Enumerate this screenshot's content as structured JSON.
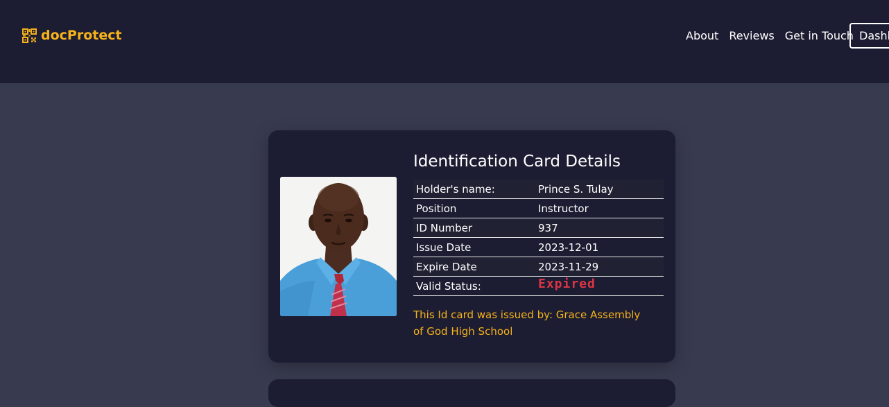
{
  "navbar": {
    "brand": "docProtect",
    "brand_icon": "qr-code-icon",
    "brand_color": "#f7b21b",
    "links": [
      "About",
      "Reviews",
      "Get in Touch"
    ],
    "dashboard_button": "Dashb"
  },
  "card": {
    "title": "Identification Card Details",
    "photo": "id-photo",
    "rows": [
      {
        "label": "Holder's name:",
        "value": "Prince S. Tulay"
      },
      {
        "label": "Position",
        "value": "Instructor"
      },
      {
        "label": "ID Number",
        "value": "937"
      },
      {
        "label": "Issue Date",
        "value": "2023-12-01"
      },
      {
        "label": "Expire Date",
        "value": "2023-11-29"
      }
    ],
    "status": {
      "label": "Valid Status:",
      "value": "Expired",
      "color": "#dc3545"
    },
    "issuer_text": "This Id card was issued by: Grace Assembly of God High School"
  },
  "colors": {
    "page_bg": "#383a4f",
    "navbar_bg": "#1c1d32",
    "card_bg": "#1c1d32",
    "accent": "#f7b21b"
  }
}
